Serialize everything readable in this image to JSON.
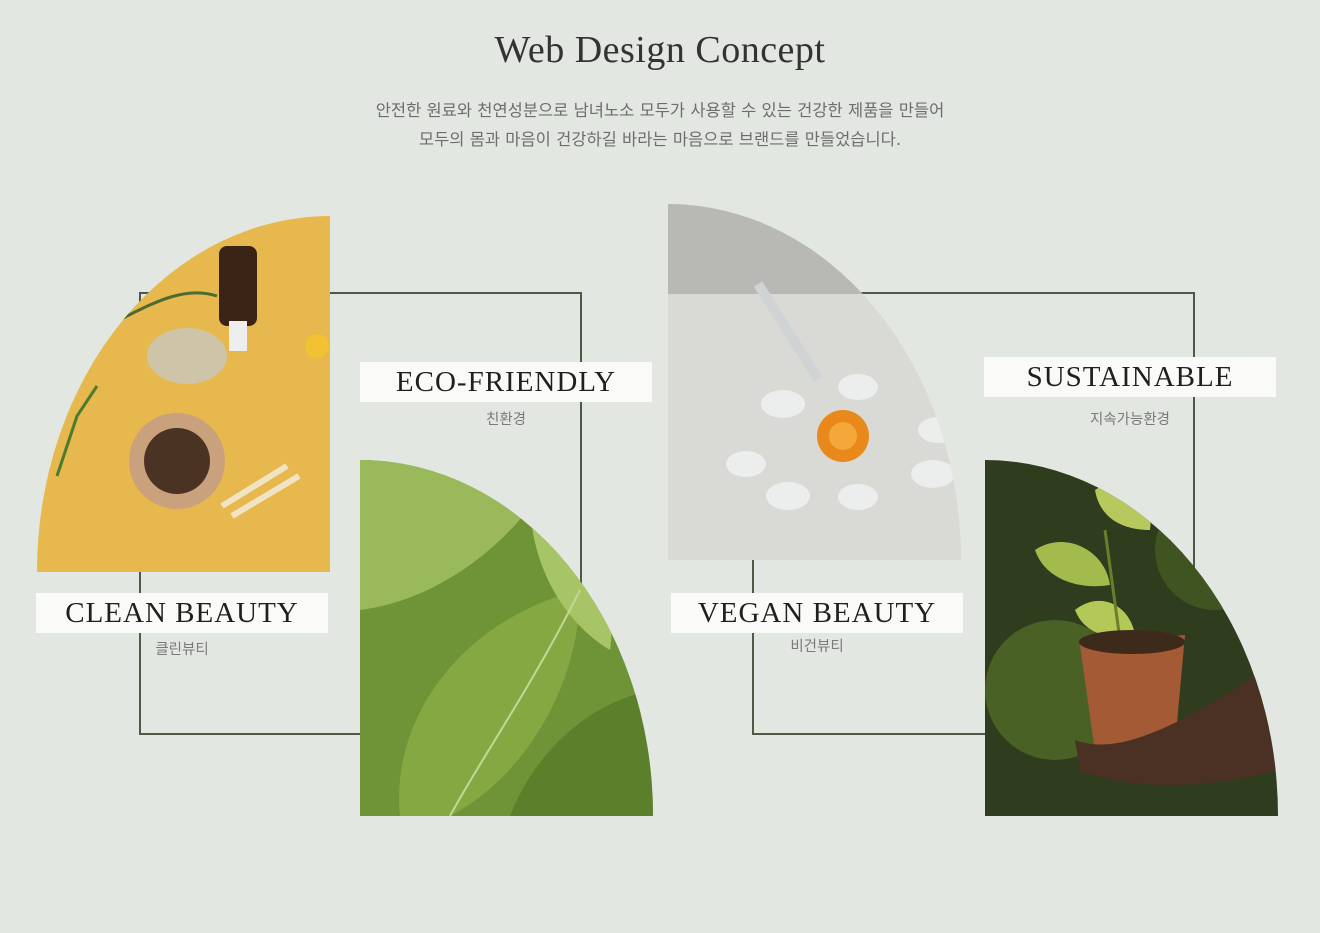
{
  "header": {
    "title": "Web Design Concept",
    "description_line1": "안전한 원료와 천연성분으로 남녀노소 모두가 사용할 수 있는 건강한 제품을 만들어",
    "description_line2": "모두의 몸과 마음이 건강하길 바라는 마음으로 브랜드를 만들었습니다."
  },
  "concepts": [
    {
      "label": "CLEAN BEAUTY",
      "sub": "클린뷰티"
    },
    {
      "label": "ECO-FRIENDLY",
      "sub": "친환경"
    },
    {
      "label": "VEGAN BEAUTY",
      "sub": "비건뷰티"
    },
    {
      "label": "SUSTAINABLE",
      "sub": "지속가능환경"
    }
  ],
  "colors": {
    "background": "#e3e7e2",
    "frame_line": "#4c5a46",
    "label_bg": "#fafaf8"
  }
}
